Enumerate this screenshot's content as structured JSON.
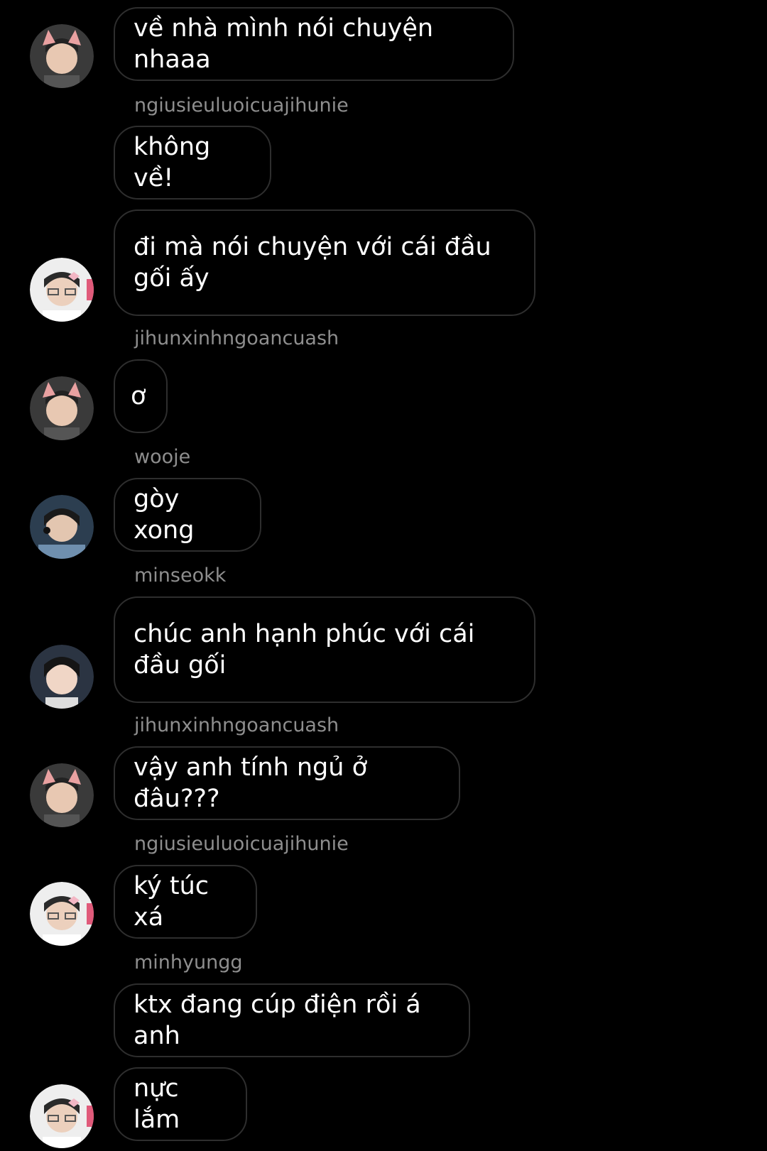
{
  "conversation": {
    "messages": [
      {
        "text": "về nhà mình nói chuyện nhaaa",
        "avatar": "avatar-a"
      },
      {
        "username": "ngiusieuluoicuajihunie",
        "text": "không về!"
      },
      {
        "text": "đi mà nói chuyện với cái đầu gối ấy",
        "avatar": "avatar-b"
      },
      {
        "username": "jihunxinhngoancuash",
        "text": "ơ",
        "avatar": "avatar-a"
      },
      {
        "username": "wooje",
        "text": "gòy xong",
        "avatar": "avatar-c"
      },
      {
        "username": "minseokk",
        "text": "chúc anh hạnh phúc với cái đầu gối",
        "avatar": "avatar-d"
      },
      {
        "username": "jihunxinhngoancuash",
        "text": "vậy anh tính ngủ ở đâu???",
        "avatar": "avatar-a"
      },
      {
        "username": "ngiusieuluoicuajihunie",
        "text": "ký túc xá",
        "avatar": "avatar-b"
      },
      {
        "username": "minhyungg",
        "text": "ktx đang cúp điện rồi á anh"
      },
      {
        "text": "nực lắm",
        "avatar": "avatar-b"
      }
    ]
  },
  "colors": {
    "background": "#000000",
    "bubble_border": "#2e2e2e",
    "username_text": "#8e8e8e",
    "message_text": "#ffffff"
  }
}
